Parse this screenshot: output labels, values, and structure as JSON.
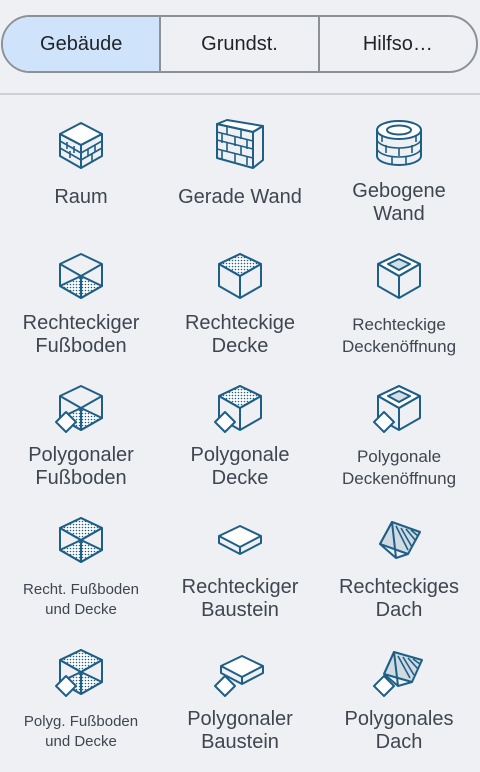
{
  "tabs": [
    {
      "label": "Gebäude",
      "active": true
    },
    {
      "label": "Grundst.",
      "active": false
    },
    {
      "label": "Hilfso…",
      "active": false
    }
  ],
  "tools": [
    {
      "label": "Raum",
      "icon": "room-icon"
    },
    {
      "label": "Gerade Wand",
      "icon": "straight-wall-icon"
    },
    {
      "label": "Gebogene\nWand",
      "icon": "curved-wall-icon"
    },
    {
      "label": "Rechteckiger\nFußboden",
      "icon": "rectangular-floor-icon"
    },
    {
      "label": "Rechteckige\nDecke",
      "icon": "rectangular-ceiling-icon"
    },
    {
      "label": "Rechteckige\nDeckenöffnung",
      "icon": "rectangular-ceiling-opening-icon"
    },
    {
      "label": "Polygonaler\nFußboden",
      "icon": "polygonal-floor-icon"
    },
    {
      "label": "Polygonale\nDecke",
      "icon": "polygonal-ceiling-icon"
    },
    {
      "label": "Polygonale\nDeckenöffnung",
      "icon": "polygonal-ceiling-opening-icon"
    },
    {
      "label": "Recht. Fußboden\nund Decke",
      "icon": "rectangular-floor-and-ceiling-icon"
    },
    {
      "label": "Rechteckiger\nBaustein",
      "icon": "rectangular-block-icon"
    },
    {
      "label": "Rechteckiges\nDach",
      "icon": "rectangular-roof-icon"
    },
    {
      "label": "Polyg. Fußboden\nund Decke",
      "icon": "polygonal-floor-and-ceiling-icon"
    },
    {
      "label": "Polygonaler\nBaustein",
      "icon": "polygonal-block-icon"
    },
    {
      "label": "Polygonales\nDach",
      "icon": "polygonal-roof-icon"
    }
  ],
  "colors": {
    "icon_stroke": "#1f5f86",
    "tab_active_bg": "#cfe4fb",
    "background": "#eef0f3",
    "label_text": "#3f4650"
  }
}
